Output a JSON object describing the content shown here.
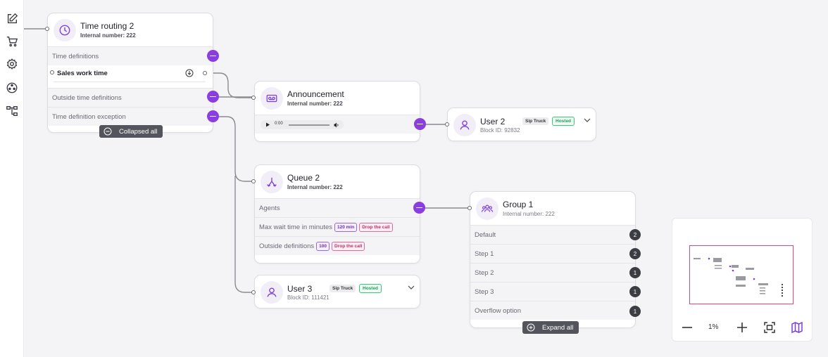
{
  "sidebar": {
    "items": [
      {
        "icon": "edit-icon"
      },
      {
        "icon": "cart-icon"
      },
      {
        "icon": "settings-icon"
      },
      {
        "icon": "nodes-icon"
      },
      {
        "icon": "tree-icon"
      }
    ]
  },
  "colors": {
    "accent": "#8a3ee0",
    "pink_tag": "#e4689a",
    "green_tag": "#3cc47c"
  },
  "time_routing": {
    "title": "Time routing 2",
    "subtitle": "Internal number: 222",
    "rows": {
      "time_definitions": "Time definitions",
      "sales_work_time": "Sales work time",
      "outside_time": "Outside time  definitions",
      "exception": "Time definition exception"
    },
    "collapse_label": "Collapsed all"
  },
  "announcement": {
    "title": "Announcement",
    "subtitle": "Internal number: 222",
    "audio_time": "0:00"
  },
  "user2": {
    "title": "User 2",
    "subtitle": "Block ID: 92832",
    "badge_trunk": "Sip Truck",
    "badge_status": "Hosted"
  },
  "queue": {
    "title": "Queue 2",
    "subtitle": "Internal number: 222",
    "rows": {
      "agents": "Agents",
      "max_wait": "Max wait time in minutes",
      "max_wait_tag": "120 min",
      "max_wait_action": "Drop the call",
      "outside": "Outside definitions",
      "outside_tag": "100",
      "outside_action": "Drop the call"
    }
  },
  "user3": {
    "title": "User 3",
    "subtitle": "Block ID: 111421",
    "badge_trunk": "Sip Truck",
    "badge_status": "Hosted"
  },
  "group": {
    "title": "Group 1",
    "subtitle": "Internal number: 222",
    "rows": [
      {
        "label": "Default",
        "count": "2"
      },
      {
        "label": "Step 1",
        "count": "2"
      },
      {
        "label": "Step 2",
        "count": "1"
      },
      {
        "label": "Step 3",
        "count": "1"
      },
      {
        "label": "Overflow option",
        "count": "1"
      }
    ],
    "expand_label": "Expand all"
  },
  "minimap": {
    "zoom": "1%"
  }
}
